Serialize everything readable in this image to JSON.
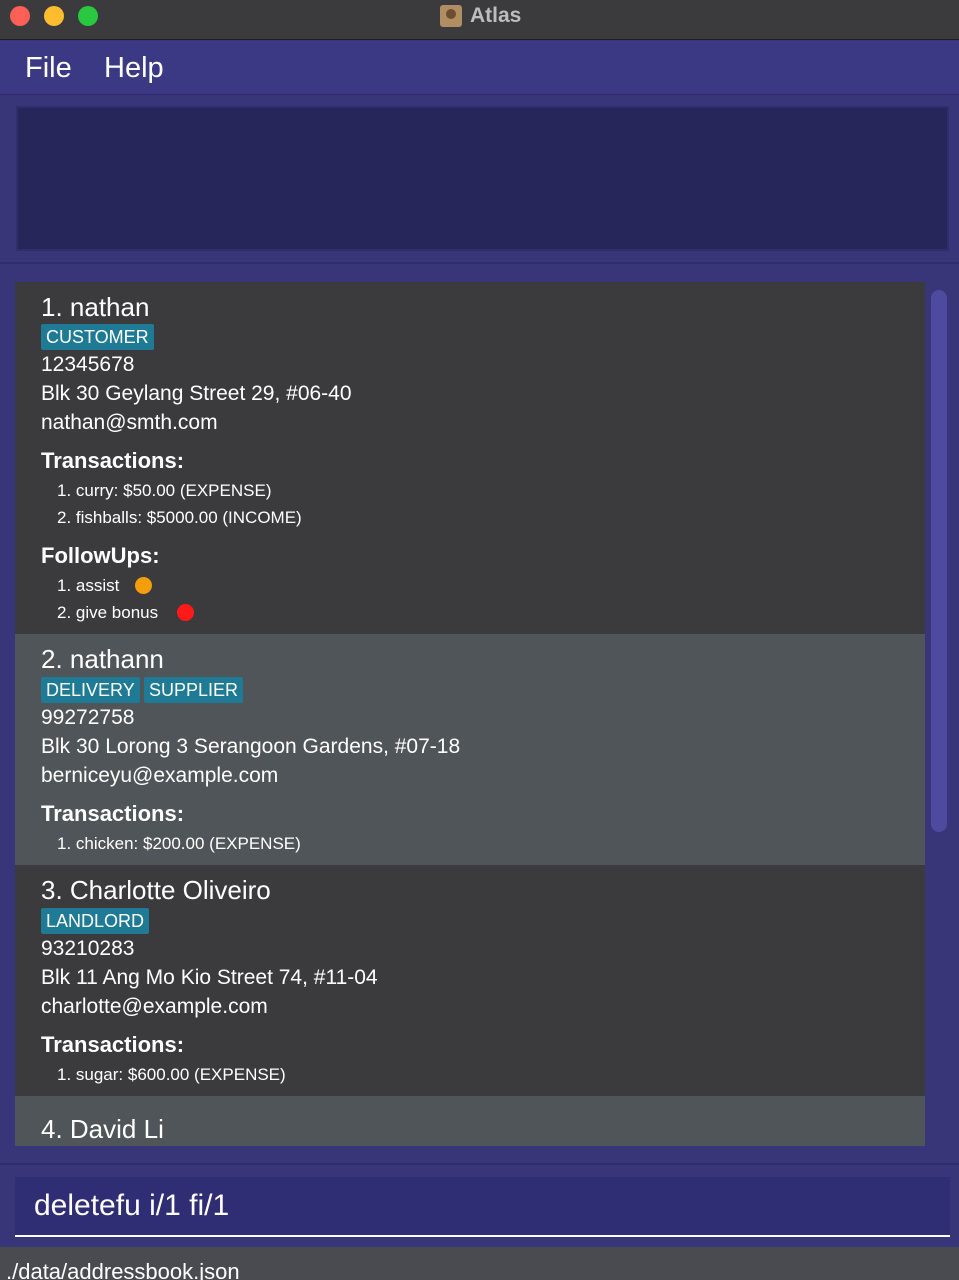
{
  "window": {
    "title": "Atlas"
  },
  "menu": {
    "file": "File",
    "help": "Help"
  },
  "result_display": {
    "text": ""
  },
  "persons": [
    {
      "name": "1. nathan",
      "tags": [
        "CUSTOMER"
      ],
      "phone": "12345678",
      "address": "Blk 30 Geylang Street 29, #06-40",
      "email": "nathan@smth.com",
      "transactions_label": "Transactions:",
      "transactions": [
        "1. curry: $50.00 (EXPENSE)",
        "2. fishballs: $5000.00 (INCOME)"
      ],
      "followups_label": "FollowUps:",
      "followups": [
        {
          "text": "1. assist",
          "urgency_color": "#f59e0b"
        },
        {
          "text": "2. give bonus",
          "urgency_color": "#ff1a1a"
        }
      ]
    },
    {
      "name": "2. nathann",
      "tags": [
        "DELIVERY",
        "SUPPLIER"
      ],
      "phone": "99272758",
      "address": "Blk 30 Lorong 3 Serangoon Gardens, #07-18",
      "email": "berniceyu@example.com",
      "transactions_label": "Transactions:",
      "transactions": [
        "1. chicken: $200.00 (EXPENSE)"
      ]
    },
    {
      "name": "3. Charlotte Oliveiro",
      "tags": [
        "LANDLORD"
      ],
      "phone": "93210283",
      "address": "Blk 11 Ang Mo Kio Street 74, #11-04",
      "email": "charlotte@example.com",
      "transactions_label": "Transactions:",
      "transactions": [
        "1. sugar: $600.00 (EXPENSE)"
      ]
    },
    {
      "name": "4. David Li"
    }
  ],
  "command": {
    "value": "deletefu i/1 fi/1"
  },
  "status": {
    "path": "./data/addressbook.json"
  },
  "colors": {
    "background": "#383579",
    "tag": "#1f7a95",
    "card_dark": "#3b3b3d",
    "card_light": "#4f5558"
  }
}
